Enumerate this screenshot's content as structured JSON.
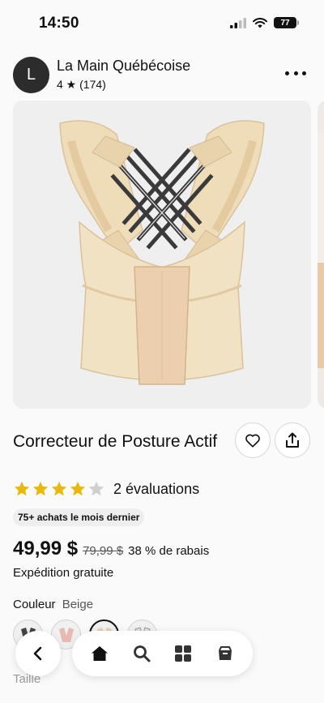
{
  "status": {
    "time": "14:50",
    "battery": "77"
  },
  "shop": {
    "initial": "L",
    "name": "La Main Québécoise",
    "rating": "4 ★ (174)"
  },
  "product": {
    "title": "Correcteur de Posture Actif",
    "rating_value": 4,
    "rating_max": 5,
    "reviews": "2 évaluations",
    "badge": "75+ achats le mois dernier",
    "price": "49,99 $",
    "old_price": "79,99 $",
    "discount": "38 % de rabais",
    "shipping": "Expédition gratuite"
  },
  "options": {
    "color_label": "Couleur",
    "color_value": "Beige",
    "size_label": "Taille"
  },
  "colors": {
    "star": "#e8b80f",
    "star_empty": "#cfcfcf",
    "garment": "#efdcb9"
  },
  "icons": {
    "more": "more-icon",
    "favorite": "heart-icon",
    "share": "share-icon",
    "back": "chevron-left-icon",
    "home": "home-icon",
    "search": "search-icon",
    "categories": "grid-icon",
    "shop": "bag-icon"
  }
}
